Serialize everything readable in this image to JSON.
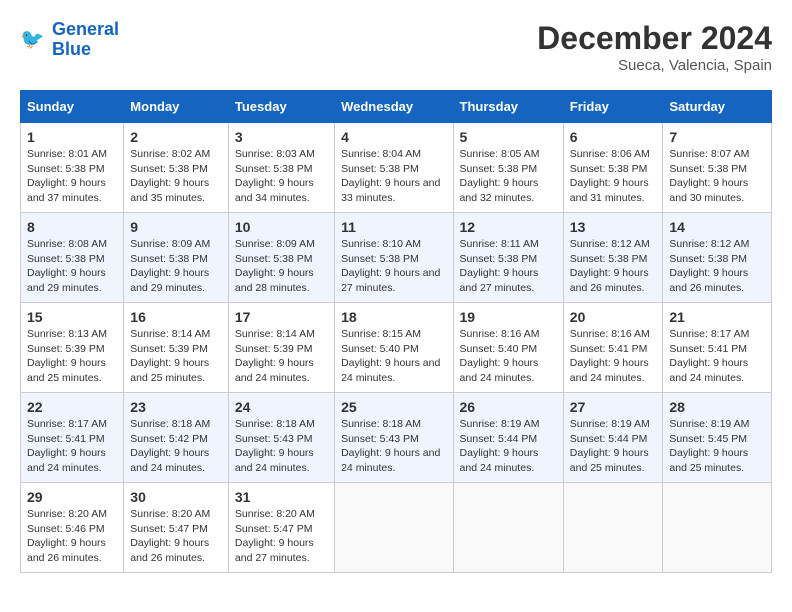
{
  "header": {
    "logo_line1": "General",
    "logo_line2": "Blue",
    "month_year": "December 2024",
    "location": "Sueca, Valencia, Spain"
  },
  "weekdays": [
    "Sunday",
    "Monday",
    "Tuesday",
    "Wednesday",
    "Thursday",
    "Friday",
    "Saturday"
  ],
  "weeks": [
    [
      {
        "day": 1,
        "rise": "8:01 AM",
        "set": "5:38 PM",
        "hours": "9 hours and 37 minutes."
      },
      {
        "day": 2,
        "rise": "8:02 AM",
        "set": "5:38 PM",
        "hours": "9 hours and 35 minutes."
      },
      {
        "day": 3,
        "rise": "8:03 AM",
        "set": "5:38 PM",
        "hours": "9 hours and 34 minutes."
      },
      {
        "day": 4,
        "rise": "8:04 AM",
        "set": "5:38 PM",
        "hours": "9 hours and 33 minutes."
      },
      {
        "day": 5,
        "rise": "8:05 AM",
        "set": "5:38 PM",
        "hours": "9 hours and 32 minutes."
      },
      {
        "day": 6,
        "rise": "8:06 AM",
        "set": "5:38 PM",
        "hours": "9 hours and 31 minutes."
      },
      {
        "day": 7,
        "rise": "8:07 AM",
        "set": "5:38 PM",
        "hours": "9 hours and 30 minutes."
      }
    ],
    [
      {
        "day": 8,
        "rise": "8:08 AM",
        "set": "5:38 PM",
        "hours": "9 hours and 29 minutes."
      },
      {
        "day": 9,
        "rise": "8:09 AM",
        "set": "5:38 PM",
        "hours": "9 hours and 29 minutes."
      },
      {
        "day": 10,
        "rise": "8:09 AM",
        "set": "5:38 PM",
        "hours": "9 hours and 28 minutes."
      },
      {
        "day": 11,
        "rise": "8:10 AM",
        "set": "5:38 PM",
        "hours": "9 hours and 27 minutes."
      },
      {
        "day": 12,
        "rise": "8:11 AM",
        "set": "5:38 PM",
        "hours": "9 hours and 27 minutes."
      },
      {
        "day": 13,
        "rise": "8:12 AM",
        "set": "5:38 PM",
        "hours": "9 hours and 26 minutes."
      },
      {
        "day": 14,
        "rise": "8:12 AM",
        "set": "5:38 PM",
        "hours": "9 hours and 26 minutes."
      }
    ],
    [
      {
        "day": 15,
        "rise": "8:13 AM",
        "set": "5:39 PM",
        "hours": "9 hours and 25 minutes."
      },
      {
        "day": 16,
        "rise": "8:14 AM",
        "set": "5:39 PM",
        "hours": "9 hours and 25 minutes."
      },
      {
        "day": 17,
        "rise": "8:14 AM",
        "set": "5:39 PM",
        "hours": "9 hours and 24 minutes."
      },
      {
        "day": 18,
        "rise": "8:15 AM",
        "set": "5:40 PM",
        "hours": "9 hours and 24 minutes."
      },
      {
        "day": 19,
        "rise": "8:16 AM",
        "set": "5:40 PM",
        "hours": "9 hours and 24 minutes."
      },
      {
        "day": 20,
        "rise": "8:16 AM",
        "set": "5:41 PM",
        "hours": "9 hours and 24 minutes."
      },
      {
        "day": 21,
        "rise": "8:17 AM",
        "set": "5:41 PM",
        "hours": "9 hours and 24 minutes."
      }
    ],
    [
      {
        "day": 22,
        "rise": "8:17 AM",
        "set": "5:41 PM",
        "hours": "9 hours and 24 minutes."
      },
      {
        "day": 23,
        "rise": "8:18 AM",
        "set": "5:42 PM",
        "hours": "9 hours and 24 minutes."
      },
      {
        "day": 24,
        "rise": "8:18 AM",
        "set": "5:43 PM",
        "hours": "9 hours and 24 minutes."
      },
      {
        "day": 25,
        "rise": "8:18 AM",
        "set": "5:43 PM",
        "hours": "9 hours and 24 minutes."
      },
      {
        "day": 26,
        "rise": "8:19 AM",
        "set": "5:44 PM",
        "hours": "9 hours and 24 minutes."
      },
      {
        "day": 27,
        "rise": "8:19 AM",
        "set": "5:44 PM",
        "hours": "9 hours and 25 minutes."
      },
      {
        "day": 28,
        "rise": "8:19 AM",
        "set": "5:45 PM",
        "hours": "9 hours and 25 minutes."
      }
    ],
    [
      {
        "day": 29,
        "rise": "8:20 AM",
        "set": "5:46 PM",
        "hours": "9 hours and 26 minutes."
      },
      {
        "day": 30,
        "rise": "8:20 AM",
        "set": "5:47 PM",
        "hours": "9 hours and 26 minutes."
      },
      {
        "day": 31,
        "rise": "8:20 AM",
        "set": "5:47 PM",
        "hours": "9 hours and 27 minutes."
      },
      null,
      null,
      null,
      null
    ]
  ],
  "labels": {
    "sunrise": "Sunrise:",
    "sunset": "Sunset:",
    "daylight": "Daylight:"
  }
}
